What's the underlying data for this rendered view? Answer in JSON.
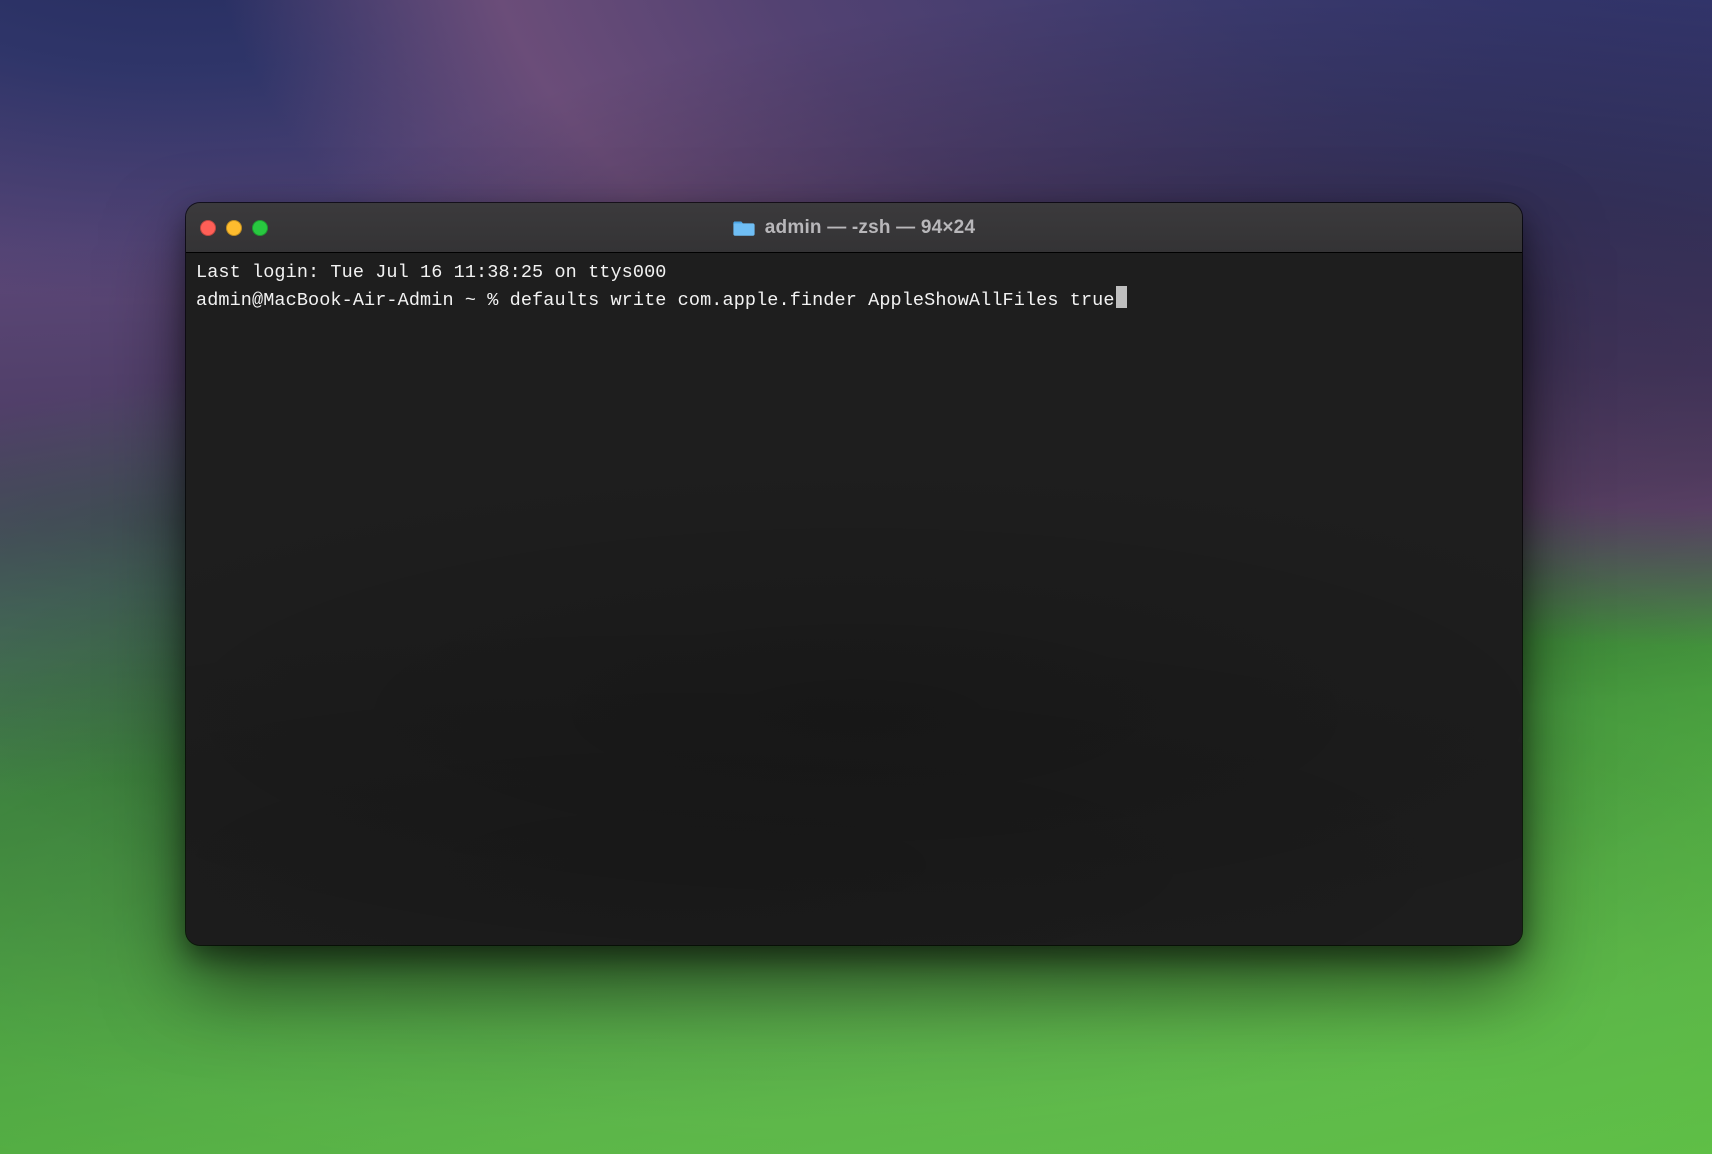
{
  "window": {
    "title": "admin — -zsh — 94×24",
    "icon": "folder-icon",
    "traffic_lights": {
      "close_color": "#ff5f57",
      "minimize_color": "#febc2e",
      "zoom_color": "#28c840"
    }
  },
  "terminal": {
    "last_login": "Last login: Tue Jul 16 11:38:25 on ttys000",
    "prompt": "admin@MacBook-Air-Admin ~ % ",
    "command": "defaults write com.apple.finder AppleShowAllFiles true",
    "font_color": "#f2f2f2",
    "background_color": "#1e1e1e",
    "cursor_color": "#bfbfbf"
  }
}
